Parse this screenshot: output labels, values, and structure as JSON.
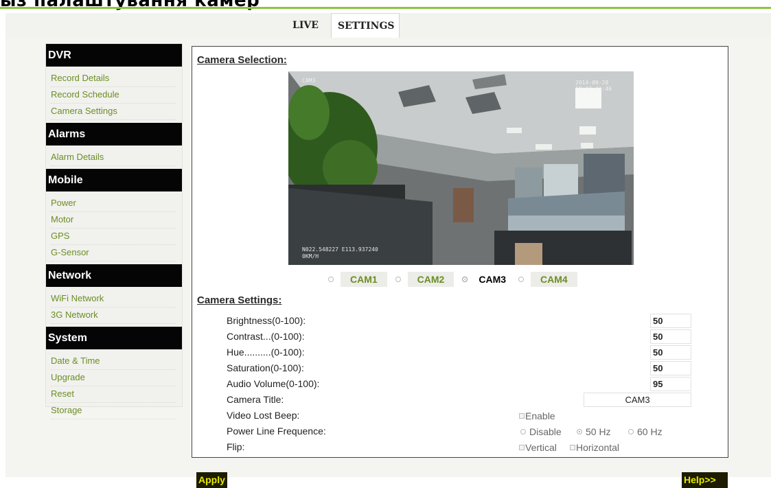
{
  "page": {
    "heading": "ыз палаштування камер"
  },
  "tabs": [
    {
      "label": "LIVE"
    },
    {
      "label": "SETTINGS"
    }
  ],
  "sidebar": [
    {
      "heading": "DVR",
      "items": [
        "Record Details",
        "Record Schedule",
        "Camera Settings"
      ]
    },
    {
      "heading": "Alarms",
      "items": [
        "Alarm Details"
      ]
    },
    {
      "heading": "Mobile",
      "items": [
        "Power",
        "Motor",
        "GPS",
        "G-Sensor"
      ]
    },
    {
      "heading": "Network",
      "items": [
        "WiFi Network",
        "3G Network"
      ]
    },
    {
      "heading": "System",
      "items": [
        "Date & Time",
        "Upgrade",
        "Reset",
        "Storage"
      ]
    }
  ],
  "camera_selection": {
    "title": "Camera Selection:",
    "overlay": {
      "label": "CAM3",
      "date": "2014-09-28",
      "time": "19:03:41:46",
      "coords": "N022.548227 E113.937240",
      "speed": "0KM/H"
    },
    "cams": [
      {
        "label": "CAM1",
        "selected": false
      },
      {
        "label": "CAM2",
        "selected": false
      },
      {
        "label": "CAM3",
        "selected": true
      },
      {
        "label": "CAM4",
        "selected": false
      }
    ]
  },
  "camera_settings": {
    "title": "Camera Settings:",
    "brightness": {
      "label": "Brightness(0-100):",
      "value": "50"
    },
    "contrast": {
      "label": "Contrast...(0-100):",
      "value": "50"
    },
    "hue": {
      "label": "Hue..........(0-100):",
      "value": "50"
    },
    "saturation": {
      "label": "Saturation(0-100):",
      "value": "50"
    },
    "audio_volume": {
      "label": "Audio Volume(0-100):",
      "value": "95"
    },
    "camera_title": {
      "label": "Camera Title:",
      "value": "CAM3"
    },
    "video_lost_beep": {
      "label": "Video Lost Beep:",
      "option": "Enable",
      "checked": false
    },
    "power_line": {
      "label": "Power Line Frequence:",
      "options": [
        "Disable",
        "50 Hz",
        "60 Hz"
      ],
      "selected": "50 Hz"
    },
    "flip": {
      "label": "Flip:",
      "options": [
        "Vertical",
        "Horizontal"
      ]
    }
  },
  "buttons": {
    "apply": "Apply",
    "help": "Help>>"
  },
  "colors": {
    "accent_green": "#8cc63f",
    "link_green": "#6b8e23",
    "sidebar_heading_bg": "#050505",
    "button_text": "#e8e800"
  }
}
